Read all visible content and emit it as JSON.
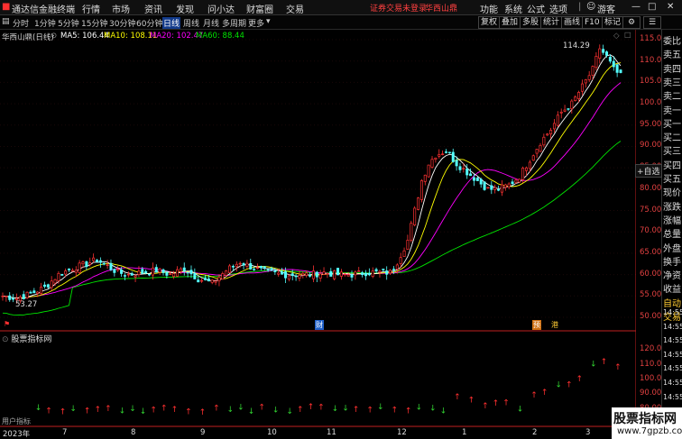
{
  "menubar": {
    "app_title": "通达信金融终端",
    "items": [
      "行情",
      "市场",
      "资讯",
      "发现",
      "问小达",
      "财富圈",
      "交易"
    ],
    "status_notice": "证券交易未登录",
    "stock_name": "华西山鼎",
    "right_items": [
      "功能",
      "系统",
      "公式",
      "选项"
    ],
    "user": "游客"
  },
  "toolbar": {
    "periods": [
      "分时",
      "1分钟",
      "5分钟",
      "15分钟",
      "30分钟",
      "60分钟",
      "日线",
      "周线",
      "月线",
      "多周期",
      "更多"
    ],
    "active_period": "日线",
    "buttons": [
      "复权",
      "叠加",
      "多股",
      "统计",
      "画线",
      "F10",
      "标记"
    ],
    "self_select": "+自选"
  },
  "legend": {
    "title": "华西山鼎(日线)",
    "ma5": "MA5: 106.44",
    "ma10": "MA10: 108.11",
    "ma20": "MA20: 102.47",
    "ma60": "MA60: 88.44"
  },
  "colors": {
    "up": "#ff3232",
    "down": "#54ffff",
    "ma5": "#ffffff",
    "ma10": "#ffff00",
    "ma20": "#ff00ff",
    "ma60": "#00e600",
    "axis": "#e04040"
  },
  "price_axis": [
    "115.00",
    "110.00",
    "105.00",
    "100.00",
    "95.00",
    "90.00",
    "85.00",
    "80.00",
    "75.00",
    "70.00",
    "65.00",
    "60.00",
    "55.00",
    "50.00"
  ],
  "annotations": {
    "high": "114.29",
    "low": "53.27",
    "events": [
      "财",
      "预",
      "港"
    ]
  },
  "indicator": {
    "name": "股票指标网",
    "axis": [
      "120.00",
      "110.00",
      "100.00",
      "90.00",
      "80.00"
    ],
    "bottom_text": "用户指标"
  },
  "date_axis": [
    "2023年",
    "7",
    "8",
    "9",
    "10",
    "11",
    "12",
    "1",
    "2",
    "3"
  ],
  "right_panel": {
    "labels": [
      "委比",
      "卖五",
      "卖四",
      "卖三",
      "卖二",
      "卖一",
      "买一",
      "买二",
      "买三",
      "买四",
      "买五",
      "现价",
      "涨跌",
      "涨幅",
      "总量",
      "外盘",
      "换手",
      "净资",
      "收益",
      "自动",
      "交易"
    ],
    "times": [
      "14:55",
      "14:55",
      "14:55",
      "14:55",
      "14:55",
      "14:55",
      "14:55",
      "14:55",
      "14:55",
      "14:55",
      "14:55",
      "14:55",
      "14:55",
      "14:55",
      "14:55",
      "14:55",
      "14:55",
      "14:55",
      "14:55"
    ]
  },
  "watermark": {
    "line1": "股票指标网",
    "line2": "www.7gpzb.com"
  },
  "chart_data": {
    "type": "candlestick",
    "title": "华西山鼎(日线)",
    "y_range": [
      48,
      116
    ],
    "moving_averages": {
      "MA5": 106.44,
      "MA10": 108.11,
      "MA20": 102.47,
      "MA60": 88.44
    },
    "high": 114.29,
    "low": 53.27,
    "close_path": [
      [
        0,
        55
      ],
      [
        4,
        54.5
      ],
      [
        8,
        55.5
      ],
      [
        12,
        57
      ],
      [
        16,
        60
      ],
      [
        20,
        61.5
      ],
      [
        24,
        62.5
      ],
      [
        27,
        63.5
      ],
      [
        30,
        62
      ],
      [
        33,
        60.5
      ],
      [
        36,
        60
      ],
      [
        40,
        60.5
      ],
      [
        44,
        61
      ],
      [
        48,
        60
      ],
      [
        52,
        61.5
      ],
      [
        56,
        59
      ],
      [
        60,
        58
      ],
      [
        64,
        61
      ],
      [
        68,
        63
      ],
      [
        72,
        61.5
      ],
      [
        76,
        60.5
      ],
      [
        80,
        60
      ],
      [
        84,
        60
      ],
      [
        88,
        60
      ],
      [
        92,
        60.5
      ],
      [
        96,
        60
      ],
      [
        100,
        60
      ],
      [
        104,
        60.5
      ],
      [
        108,
        60.5
      ],
      [
        111,
        60.5
      ],
      [
        113,
        63
      ],
      [
        116,
        68
      ],
      [
        118,
        75
      ],
      [
        120,
        82
      ],
      [
        122,
        86
      ],
      [
        124,
        88
      ],
      [
        127,
        89
      ],
      [
        130,
        86
      ],
      [
        133,
        84
      ],
      [
        136,
        82
      ],
      [
        139,
        80
      ],
      [
        142,
        80
      ],
      [
        145,
        81
      ],
      [
        148,
        83
      ],
      [
        151,
        87
      ],
      [
        154,
        91
      ],
      [
        157,
        94
      ],
      [
        160,
        98
      ],
      [
        163,
        100
      ],
      [
        166,
        104
      ],
      [
        169,
        108
      ],
      [
        171,
        113
      ],
      [
        173,
        111
      ],
      [
        175,
        108
      ],
      [
        177,
        106.5
      ]
    ]
  }
}
